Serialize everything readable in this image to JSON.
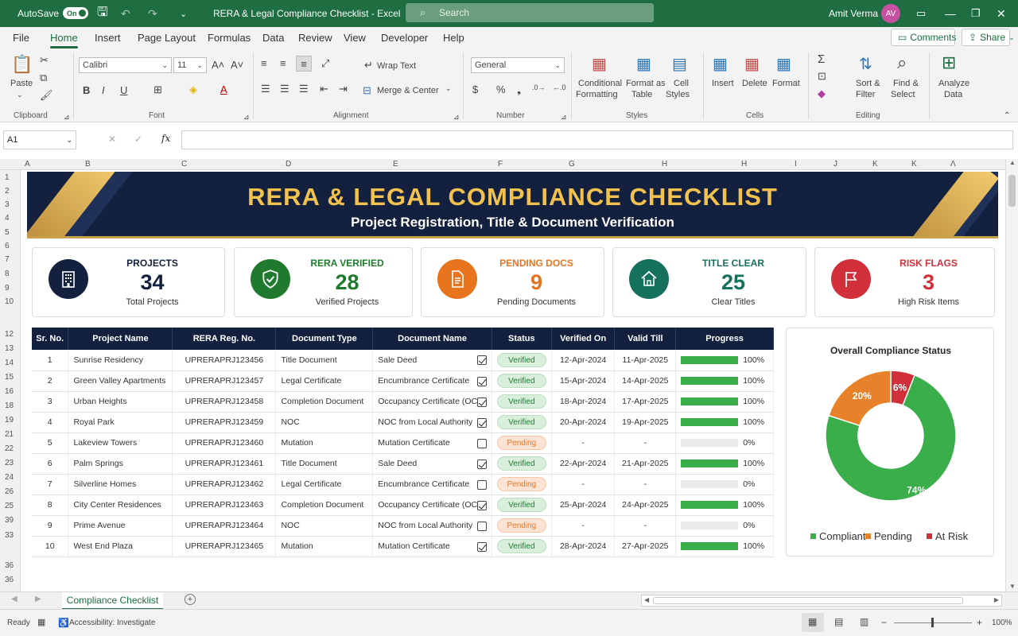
{
  "titlebar": {
    "autosave_label": "AutoSave",
    "autosave_state": "On",
    "doc_title": "RERA & Legal Compliance Checklist - Excel",
    "search_placeholder": "Search",
    "user_name": "Amit Verma",
    "user_initials": "AV"
  },
  "menu": {
    "tabs": [
      "File",
      "Home",
      "Insert",
      "Page Layout",
      "Formulas",
      "Data",
      "Review",
      "View",
      "Developer",
      "Help"
    ],
    "active": "Home",
    "comments": "Comments",
    "share": "Share"
  },
  "ribbon": {
    "paste": "Paste",
    "font_name": "Calibri",
    "font_size": "11",
    "wrap_text": "Wrap Text",
    "merge_center": "Merge & Center",
    "number_format": "General",
    "conditional_formatting": [
      "Conditional",
      "Formatting"
    ],
    "format_as_table": [
      "Format as",
      "Table"
    ],
    "cell_styles": [
      "Cell",
      "Styles"
    ],
    "insert": "Insert",
    "delete": "Delete",
    "format": "Format",
    "sort_filter": [
      "Sort &",
      "Filter"
    ],
    "find_select": [
      "Find &",
      "Select"
    ],
    "analyze_data": [
      "Analyze",
      "Data"
    ],
    "groups": [
      "Clipboard",
      "Font",
      "Alignment",
      "Number",
      "Styles",
      "Cells",
      "Editing"
    ]
  },
  "formula": {
    "name_box": "A1",
    "fx": "fx",
    "value": ""
  },
  "columns": [
    "A",
    "B",
    "C",
    "D",
    "E",
    "F",
    "G",
    "H",
    "H",
    "I",
    "J",
    "K",
    "K",
    "Λ"
  ],
  "rows": [
    "1",
    "2",
    "3",
    "4",
    "5",
    "6",
    "7",
    "8",
    "9",
    "10",
    "12",
    "13",
    "14",
    "15",
    "16",
    "18",
    "19",
    "21",
    "22",
    "23",
    "24",
    "26",
    "25",
    "39",
    "33",
    "36",
    "36"
  ],
  "banner": {
    "title": "RERA & LEGAL COMPLIANCE CHECKLIST",
    "subtitle": "Project Registration, Title & Document Verification"
  },
  "cards": [
    {
      "label": "PROJECTS",
      "value": "34",
      "sub": "Total Projects",
      "color": "#13213f",
      "icon": "building-icon"
    },
    {
      "label": "RERA VERIFIED",
      "value": "28",
      "sub": "Verified Projects",
      "color": "#1f7a2e",
      "icon": "shield-check-icon"
    },
    {
      "label": "PENDING DOCS",
      "value": "9",
      "sub": "Pending Documents",
      "color": "#e8741e",
      "icon": "document-icon"
    },
    {
      "label": "TITLE CLEAR",
      "value": "25",
      "sub": "Clear Titles",
      "color": "#15705e",
      "icon": "home-icon"
    },
    {
      "label": "RISK FLAGS",
      "value": "3",
      "sub": "High Risk Items",
      "color": "#d12f3a",
      "icon": "flag-icon"
    }
  ],
  "table": {
    "headers": [
      "Sr. No.",
      "Project Name",
      "RERA Reg. No.",
      "Document Type",
      "Document Name",
      "Status",
      "Verified On",
      "Valid Till",
      "Progress"
    ],
    "rows": [
      {
        "sr": "1",
        "project": "Sunrise Residency",
        "reg": "UPRERAPRJ123456",
        "type": "Title Document",
        "doc": "Sale Deed",
        "checked": true,
        "status": "Verified",
        "verified_on": "12-Apr-2024",
        "valid_till": "11-Apr-2025",
        "progress": 1.0,
        "progress_label": "100%"
      },
      {
        "sr": "2",
        "project": "Green Valley Apartments",
        "reg": "UPRERAPRJ123457",
        "type": "Legal Certificate",
        "doc": "Encumbrance Certificate",
        "checked": true,
        "status": "Verified",
        "verified_on": "15-Apr-2024",
        "valid_till": "14-Apr-2025",
        "progress": 1.0,
        "progress_label": "100%"
      },
      {
        "sr": "3",
        "project": "Urban Heights",
        "reg": "UPRERAPRJ123458",
        "type": "Completion Document",
        "doc": "Occupancy Certificate (OC)",
        "checked": true,
        "status": "Verified",
        "verified_on": "18-Apr-2024",
        "valid_till": "17-Apr-2025",
        "progress": 1.0,
        "progress_label": "100%"
      },
      {
        "sr": "4",
        "project": "Royal Park",
        "reg": "UPRERAPRJ123459",
        "type": "NOC",
        "doc": "NOC from Local Authority",
        "checked": true,
        "status": "Verified",
        "verified_on": "20-Apr-2024",
        "valid_till": "19-Apr-2025",
        "progress": 1.0,
        "progress_label": "100%"
      },
      {
        "sr": "5",
        "project": "Lakeview Towers",
        "reg": "UPRERAPRJ123460",
        "type": "Mutation",
        "doc": "Mutation Certificate",
        "checked": false,
        "status": "Pending",
        "verified_on": "-",
        "valid_till": "-",
        "progress": 0.0,
        "progress_label": "0%"
      },
      {
        "sr": "6",
        "project": "Palm Springs",
        "reg": "UPRERAPRJ123461",
        "type": "Title Document",
        "doc": "Sale Deed",
        "checked": true,
        "status": "Verified",
        "verified_on": "22-Apr-2024",
        "valid_till": "21-Apr-2025",
        "progress": 1.0,
        "progress_label": "100%"
      },
      {
        "sr": "7",
        "project": "Silverline Homes",
        "reg": "UPRERAPRJ123462",
        "type": "Legal Certificate",
        "doc": "Encumbrance Certificate",
        "checked": false,
        "status": "Pending",
        "verified_on": "-",
        "valid_till": "-",
        "progress": 0.0,
        "progress_label": "0%"
      },
      {
        "sr": "8",
        "project": "City Center Residences",
        "reg": "UPRERAPRJ123463",
        "type": "Completion Document",
        "doc": "Occupancy Certificate (OC)",
        "checked": true,
        "status": "Verified",
        "verified_on": "25-Apr-2024",
        "valid_till": "24-Apr-2025",
        "progress": 1.0,
        "progress_label": "100%"
      },
      {
        "sr": "9",
        "project": "Prime Avenue",
        "reg": "UPRERAPRJ123464",
        "type": "NOC",
        "doc": "NOC from Local Authority",
        "checked": false,
        "status": "Pending",
        "verified_on": "-",
        "valid_till": "-",
        "progress": 0.0,
        "progress_label": "0%"
      },
      {
        "sr": "10",
        "project": "West End Plaza",
        "reg": "UPRERAPRJ123465",
        "type": "Mutation",
        "doc": "Mutation Certificate",
        "checked": true,
        "status": "Verified",
        "verified_on": "28-Apr-2024",
        "valid_till": "27-Apr-2025",
        "progress": 1.0,
        "progress_label": "100%"
      }
    ]
  },
  "chart_data": {
    "type": "pie",
    "title": "Overall Compliance Status",
    "categories": [
      "Compliant",
      "Pending",
      "At Risk"
    ],
    "values": [
      74,
      20,
      6
    ],
    "labels": [
      "74%",
      "20%",
      "6%"
    ],
    "colors": [
      "#3aae4a",
      "#e8822a",
      "#d12f3a"
    ],
    "legend": "bottom"
  },
  "sheet_tab": "Compliance Checklist",
  "status": {
    "ready": "Ready",
    "accessibility": "Accessibility: Investigate",
    "zoom": "100%"
  }
}
